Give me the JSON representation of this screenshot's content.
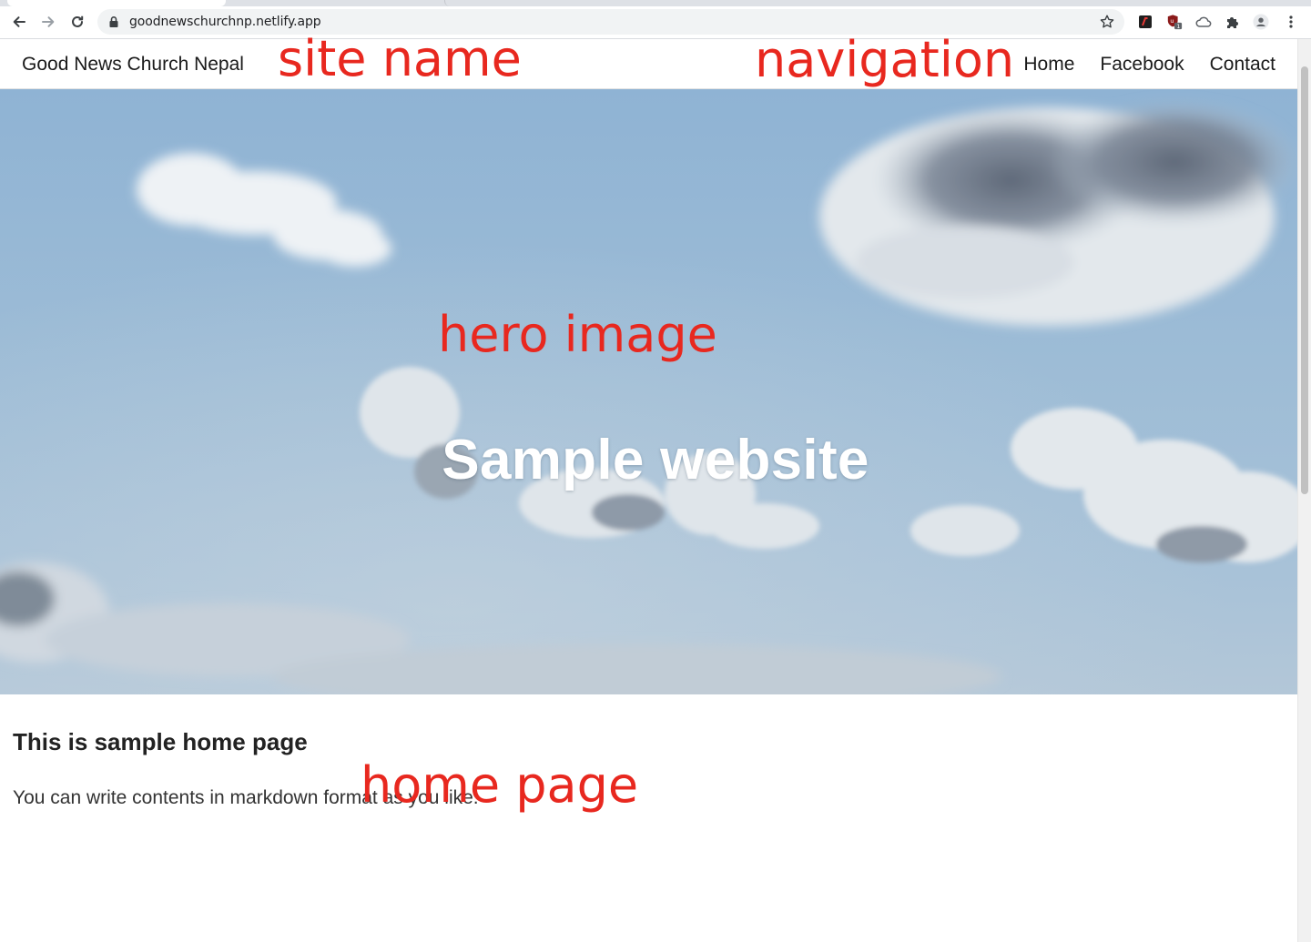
{
  "browser": {
    "url": "goodnewschurchnp.netlify.app",
    "icons": [
      "back-icon",
      "forward-icon",
      "reload-icon",
      "lock-icon",
      "star-icon",
      "extension-icon",
      "puzzle-icon",
      "profile-icon",
      "menu-icon"
    ],
    "extension_badge": "1"
  },
  "site": {
    "name": "Good News Church Nepal",
    "nav": [
      {
        "label": "Home"
      },
      {
        "label": "Facebook"
      },
      {
        "label": "Contact"
      }
    ]
  },
  "hero": {
    "title": "Sample website"
  },
  "content": {
    "heading": "This is sample home page",
    "paragraph": "You can write contents in markdown format as you like."
  },
  "annotations": {
    "site_name": "site name",
    "navigation": "navigation",
    "hero_image": "hero image",
    "home_page": "home page",
    "color": "#e8281f"
  }
}
